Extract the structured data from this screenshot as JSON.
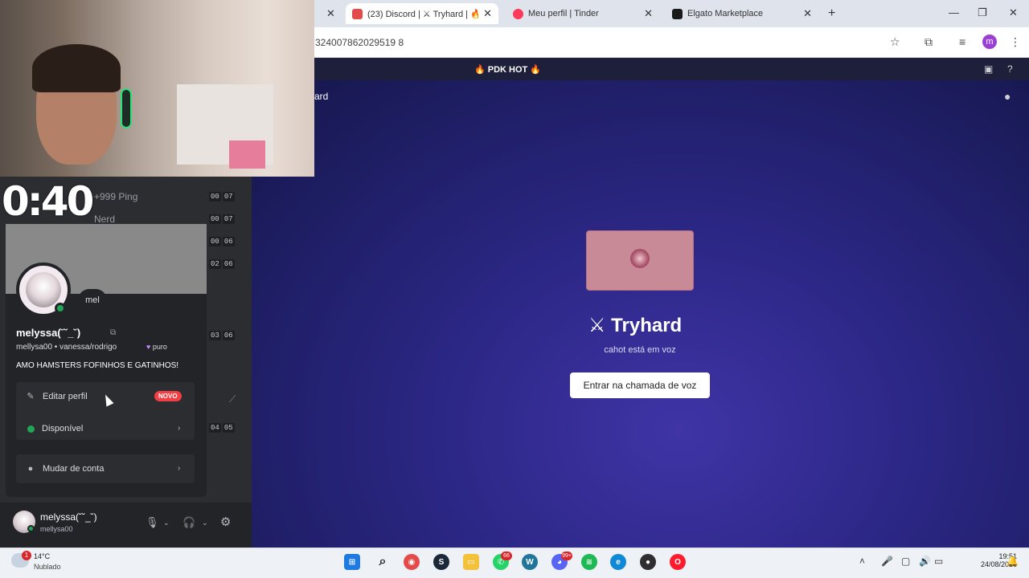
{
  "browser": {
    "tabs": [
      {
        "title": "(23) Discord | ⚔ Tryhard | 🔥 P",
        "close": "✕",
        "favicon_color": "#e34b4b",
        "active": true
      },
      {
        "title": "Meu perfil | Tinder",
        "close": "✕",
        "favicon_color": "#fd3a5c",
        "active": false
      },
      {
        "title": "Elgato Marketplace",
        "close": "✕",
        "favicon_color": "#1a1a1a",
        "active": false
      }
    ],
    "partial_tab_close": "✕",
    "new_tab": "+",
    "url": "324007862029519 8",
    "profile_letter": "m",
    "icons": [
      "star-icon",
      "extensions-icon",
      "media-icon",
      "profile-icon",
      "menu-icon"
    ]
  },
  "discord": {
    "server_title": "🔥 PDK HOT 🔥",
    "channel_fragment": "ard",
    "stage": {
      "title": "⚔ Tryhard",
      "subtitle": "cahot está em voz",
      "join_button": "Entrar na chamada de voz"
    },
    "timer": "0:40",
    "voice_rows": [
      {
        "label": "+999 Ping",
        "time": [
          "00",
          "07"
        ]
      },
      {
        "label": "Nerd",
        "time": [
          "00",
          "07"
        ]
      },
      {
        "label": "",
        "time": [
          "00",
          "06"
        ]
      },
      {
        "label": "",
        "time": [
          "02",
          "06"
        ]
      },
      {
        "label": "",
        "time": [
          "03",
          "06"
        ]
      },
      {
        "label": "",
        "time": [
          "04",
          "05"
        ]
      }
    ],
    "profile": {
      "bubble": "mel",
      "display_name": "melyssa(˘˘_˘)",
      "username": "mellysa00",
      "pronouns": "vanessa/rodrigo",
      "badge_text": "puro",
      "bio": "AMO HAMSTERS FOFINHOS E GATINHOS!",
      "menu": {
        "edit_profile": "Editar perfil",
        "new_badge": "NOVO",
        "status": "Disponível",
        "switch_account": "Mudar de conta",
        "chevron": "›"
      }
    },
    "userbar": {
      "name": "melyssa(˘˘_˘)",
      "sub": "mellysa00"
    }
  },
  "taskbar": {
    "weather_temp": "14°C",
    "weather_desc": "Nublado",
    "weather_badge": "1",
    "whatsapp_badge": "66",
    "discord_badge": "99+",
    "time": "19:51",
    "date": "24/08/2026",
    "colors": {
      "windows": "#1f7ae0",
      "search": "#222222",
      "chrome": "#e34b4b",
      "steam": "#1b2838",
      "explorer": "#f3c13a",
      "whatsapp": "#25d366",
      "wordpress": "#21759b",
      "discord": "#5865f2",
      "spotify": "#1db954",
      "edge": "#0f89d6",
      "obs": "#302e31",
      "opera": "#ff1b2d"
    }
  }
}
